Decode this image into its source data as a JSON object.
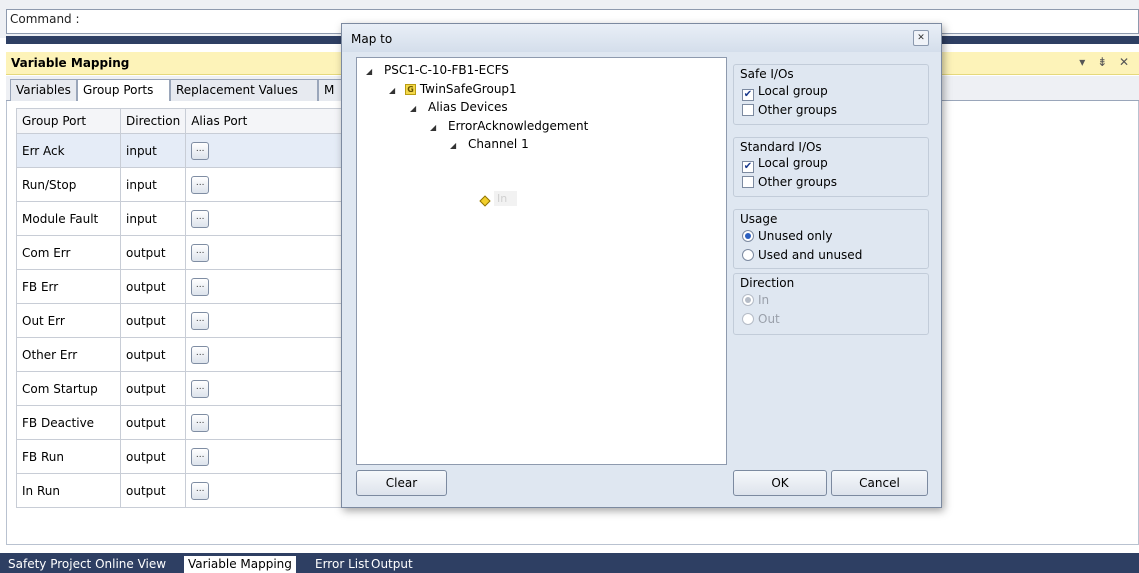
{
  "command": {
    "label": "Command :"
  },
  "panel": {
    "title": "Variable Mapping",
    "controls": "▾ ⇟ ✕"
  },
  "tabs": [
    {
      "label": "Variables"
    },
    {
      "label": "Group Ports"
    },
    {
      "label": "Replacement Values"
    },
    {
      "label": "M"
    }
  ],
  "grid": {
    "headers": [
      "Group Port",
      "Direction",
      "Alias Port"
    ],
    "ellipsis": "...",
    "rows": [
      {
        "port": "Err Ack",
        "direction": "input"
      },
      {
        "port": "Run/Stop",
        "direction": "input"
      },
      {
        "port": "Module Fault",
        "direction": "input"
      },
      {
        "port": "Com Err",
        "direction": "output"
      },
      {
        "port": "FB Err",
        "direction": "output"
      },
      {
        "port": "Out Err",
        "direction": "output"
      },
      {
        "port": "Other Err",
        "direction": "output"
      },
      {
        "port": "Com Startup",
        "direction": "output"
      },
      {
        "port": "FB Deactive",
        "direction": "output"
      },
      {
        "port": "FB Run",
        "direction": "output"
      },
      {
        "port": "In Run",
        "direction": "output"
      }
    ]
  },
  "bottom_tabs": [
    {
      "label": "Safety Project Online View"
    },
    {
      "label": "Variable Mapping"
    },
    {
      "label": "Error List"
    },
    {
      "label": "Output"
    }
  ],
  "dialog": {
    "title": "Map to",
    "close": "✕",
    "tree": {
      "root": "PSC1-C-10-FB1-ECFS",
      "group_icon": "G",
      "group": "TwinSafeGroup1",
      "alias": "Alias Devices",
      "device": "ErrorAcknowledgement",
      "channel": "Channel 1",
      "signal": "In"
    },
    "safe_ios": {
      "title": "Safe I/Os",
      "local": "Local group",
      "other": "Other groups",
      "local_checked": true,
      "other_checked": false
    },
    "standard_ios": {
      "title": "Standard I/Os",
      "local": "Local group",
      "other": "Other groups",
      "local_checked": true,
      "other_checked": false
    },
    "usage": {
      "title": "Usage",
      "unused": "Unused only",
      "both": "Used and unused",
      "selected": "unused"
    },
    "direction": {
      "title": "Direction",
      "in": "In",
      "out": "Out",
      "selected": "in",
      "enabled": false
    },
    "buttons": {
      "clear": "Clear",
      "ok": "OK",
      "cancel": "Cancel"
    }
  }
}
